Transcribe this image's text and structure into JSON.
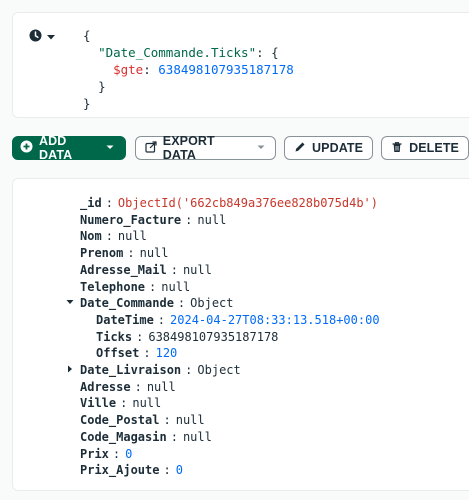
{
  "query": {
    "open": "{",
    "field": "\"Date_Commande.Ticks\"",
    "colon_brace": ": {",
    "operator": "$gte",
    "operator_colon": ":",
    "value": "638498107935187178",
    "close_inner": "}",
    "close_outer": "}"
  },
  "toolbar": {
    "add_data_label": "ADD DATA",
    "export_data_label": "EXPORT DATA",
    "update_label": "UPDATE",
    "delete_label": "DELETE"
  },
  "document": {
    "fields": [
      {
        "key": "_id",
        "value": "ObjectId('662cb849a376ee828b075d4b')",
        "type": "oid"
      },
      {
        "key": "Numero_Facture",
        "value": "null",
        "type": "null"
      },
      {
        "key": "Nom",
        "value": "null",
        "type": "null"
      },
      {
        "key": "Prenom",
        "value": "null",
        "type": "null"
      },
      {
        "key": "Adresse_Mail",
        "value": "null",
        "type": "null"
      },
      {
        "key": "Telephone",
        "value": "null",
        "type": "null"
      },
      {
        "key": "Date_Commande",
        "value": "Object",
        "type": "obj",
        "expanded": true
      },
      {
        "key": "DateTime",
        "value": "2024-04-27T08:33:13.518+00:00",
        "type": "date",
        "nested": true
      },
      {
        "key": "Ticks",
        "value": "638498107935187178",
        "type": "null",
        "nested": true
      },
      {
        "key": "Offset",
        "value": "120",
        "type": "num",
        "nested": true
      },
      {
        "key": "Date_Livraison",
        "value": "Object",
        "type": "obj",
        "expanded": false
      },
      {
        "key": "Adresse",
        "value": "null",
        "type": "null"
      },
      {
        "key": "Ville",
        "value": "null",
        "type": "null"
      },
      {
        "key": "Code_Postal",
        "value": "null",
        "type": "null"
      },
      {
        "key": "Code_Magasin",
        "value": "null",
        "type": "null"
      },
      {
        "key": "Prix",
        "value": "0",
        "type": "num"
      },
      {
        "key": "Prix_Ajoute",
        "value": "0",
        "type": "num"
      }
    ]
  }
}
